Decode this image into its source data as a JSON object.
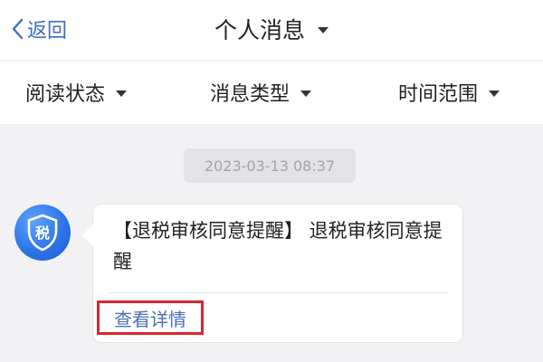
{
  "header": {
    "back_label": "返回",
    "title": "个人消息"
  },
  "filters": {
    "read_status": "阅读状态",
    "message_type": "消息类型",
    "time_range": "时间范围"
  },
  "message": {
    "timestamp": "2023-03-13 08:37",
    "avatar_text": "税",
    "content": "【退税审核同意提醒】 退税审核同意提醒",
    "detail_link": "查看详情"
  },
  "colors": {
    "accent_blue": "#3f6fbe",
    "avatar_blue": "#2a71e6",
    "highlight_red": "#d9272e"
  }
}
